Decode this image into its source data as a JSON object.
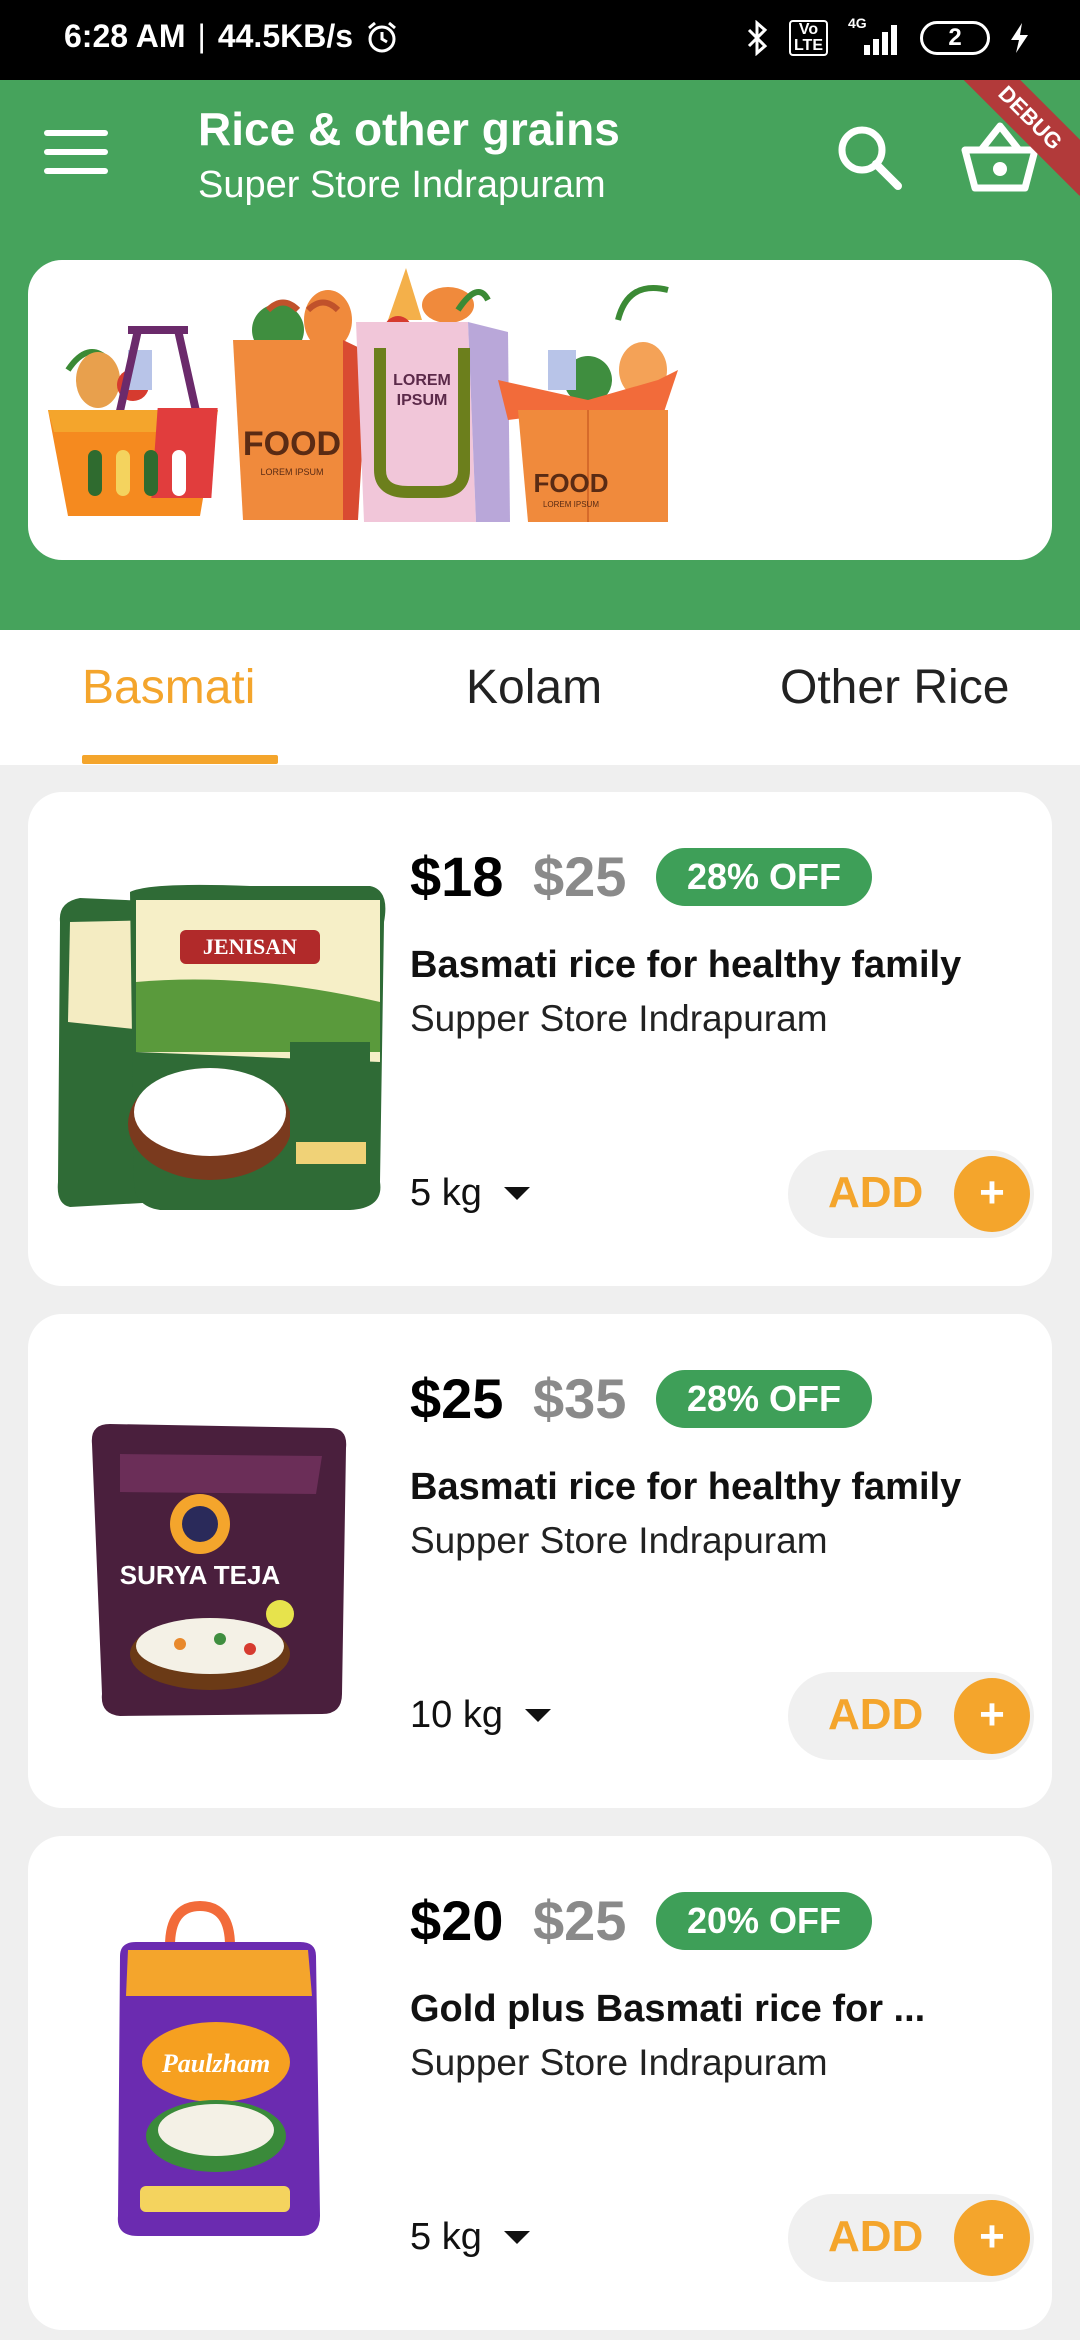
{
  "status_bar": {
    "time": "6:28 AM",
    "separator": "|",
    "net_speed": "44.5KB/s",
    "volte": "Vo\nLTE",
    "network": "4G",
    "battery": "2"
  },
  "header": {
    "title": "Rice & other grains",
    "subtitle": "Super Store Indrapuram",
    "ribbon": "DEBUG",
    "bg_color": "#46a35c"
  },
  "banner": {
    "bag1_label": "FOOD",
    "bag1_small": "LOREM IPSUM",
    "bag2_label_line1": "LOREM",
    "bag2_label_line2": "IPSUM",
    "box_label": "FOOD",
    "box_small": "LOREM IPSUM"
  },
  "tabs": [
    {
      "label": "Basmati",
      "active": true
    },
    {
      "label": "Kolam",
      "active": false
    },
    {
      "label": "Other Rice",
      "active": false
    }
  ],
  "accent_color": "#f4a52c",
  "products": [
    {
      "price": "$18",
      "old_price": "$25",
      "discount": "28% OFF",
      "name": "Basmati rice for healthy family",
      "store": "Supper Store Indrapuram",
      "qty": "5 kg",
      "add_label": "ADD",
      "plus": "+",
      "brand": "JENISAN"
    },
    {
      "price": "$25",
      "old_price": "$35",
      "discount": "28% OFF",
      "name": "Basmati rice for healthy family",
      "store": "Supper Store Indrapuram",
      "qty": "10 kg",
      "add_label": "ADD",
      "plus": "+",
      "brand": "SURYA TEJA"
    },
    {
      "price": "$20",
      "old_price": "$25",
      "discount": "20% OFF",
      "name": "Gold plus Basmati rice for ...",
      "store": "Supper Store Indrapuram",
      "qty": "5 kg",
      "add_label": "ADD",
      "plus": "+",
      "brand": "Paulzham"
    }
  ]
}
